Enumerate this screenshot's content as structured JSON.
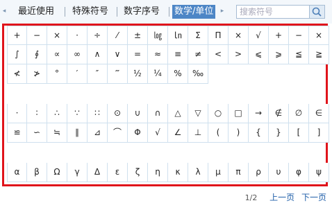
{
  "tabs": {
    "recent": "最近使用",
    "special": "特殊符号",
    "number": "数字序号",
    "math": "数学/单位",
    "left_arrow": "◂",
    "right_arrow": "▸"
  },
  "search": {
    "placeholder": "搜索符号",
    "icon": "search-icon"
  },
  "grid": {
    "row1": [
      "+",
      "−",
      "×",
      "·",
      "÷",
      "⁄",
      "±",
      "㏒",
      "㏑",
      "Σ",
      "Π",
      "×",
      "√",
      "+",
      "−",
      "×"
    ],
    "row2": [
      "∫",
      "∮",
      "∝",
      "∞",
      "∧",
      "∨",
      "=",
      "≈",
      "≡",
      "≠",
      "<",
      ">",
      "⩽",
      "⩾",
      "≦",
      "≧"
    ],
    "row3": [
      "≮",
      "≯",
      "°",
      "′",
      "″",
      "‴",
      "½",
      "¼",
      "%",
      "‰"
    ],
    "row4": [
      "·",
      "∶",
      "∴",
      "∵",
      "∷",
      "⊙",
      "∪",
      "∩",
      "△",
      "▽",
      "○",
      "□",
      "→",
      "∉",
      "∅",
      "∈"
    ],
    "row5": [
      "≌",
      "∽",
      "≒",
      "∥",
      "⊿",
      "⌒",
      "Φ",
      "√",
      "∠",
      "⊥",
      "(",
      ")",
      "{",
      "}",
      "[",
      "]"
    ],
    "row6": [
      "α",
      "β",
      "Ω",
      "γ",
      "Δ",
      "ε",
      "ζ",
      "η",
      "κ",
      "λ",
      "μ",
      "π",
      "ρ",
      "υ",
      "φ",
      "ψ"
    ]
  },
  "pager": {
    "page": "1/2",
    "prev": "上一页",
    "next": "下一页"
  },
  "colors": {
    "highlight_border": "#e0141b",
    "active_tab": "#4d86c6",
    "link": "#1d5da8"
  }
}
